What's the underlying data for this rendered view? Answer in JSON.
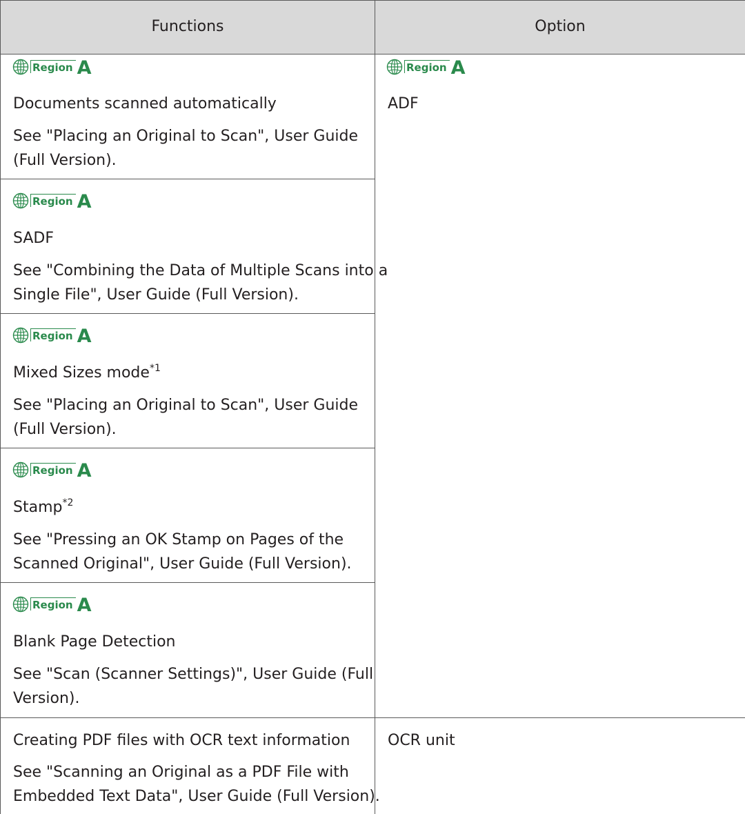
{
  "header": {
    "col1": "Functions",
    "col2": "Option"
  },
  "region_badge": {
    "label": "Region",
    "letter": "A",
    "icon": "globe-icon",
    "color": "#2a8a4c"
  },
  "rows": [
    {
      "name": "Documents scanned automatically",
      "ref_lines": [
        "See \"Placing an Original to Scan\", User Guide",
        "(Full Version)."
      ]
    },
    {
      "name": "SADF",
      "ref_lines": [
        "See \"Combining the Data of Multiple Scans into a",
        "Single File\", User Guide (Full Version)."
      ]
    },
    {
      "name": "Mixed Sizes mode",
      "note": "*1",
      "ref_lines": [
        "See \"Placing an Original to Scan\", User Guide",
        "(Full Version)."
      ]
    },
    {
      "name": "Stamp",
      "note": "*2",
      "ref_lines": [
        "See \"Pressing an OK Stamp on Pages of the",
        "Scanned Original\", User Guide (Full Version)."
      ]
    },
    {
      "name": "Blank Page Detection",
      "ref_lines": [
        "See \"Scan (Scanner Settings)\", User Guide (Full",
        "Version)."
      ]
    },
    {
      "name": "Creating PDF files with OCR text information",
      "ref_lines": [
        "See \"Scanning an Original as a PDF File with",
        "Embedded Text Data\", User Guide (Full Version)."
      ]
    }
  ],
  "options": {
    "adf": "ADF",
    "ocr": "OCR unit"
  }
}
